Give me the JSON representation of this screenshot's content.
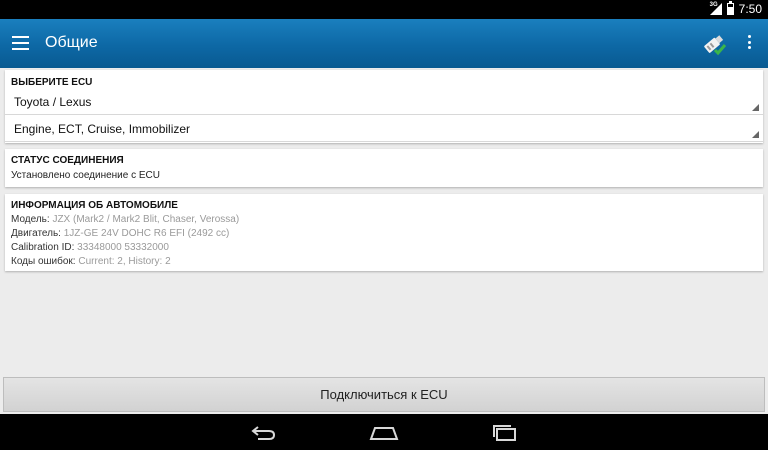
{
  "status_bar": {
    "time": "7:50",
    "network": "3G"
  },
  "app_bar": {
    "title": "Общие"
  },
  "ecu_card": {
    "title": "ВЫБЕРИТЕ ECU",
    "make_selected": "Toyota / Lexus",
    "system_selected": "Engine, ECT, Cruise, Immobilizer"
  },
  "status_card": {
    "title": "СТАТУС СОЕДИНЕНИЯ",
    "text": "Установлено соединение с ECU"
  },
  "vehicle_card": {
    "title": "ИНФОРМАЦИЯ ОБ АВТОМОБИЛЕ",
    "rows": [
      {
        "label": "Модель:",
        "value": "JZX (Mark2 / Mark2 Blit, Chaser, Verossa)"
      },
      {
        "label": "Двигатель:",
        "value": "1JZ-GE 24V DOHC R6 EFI (2492 cc)"
      },
      {
        "label": "Calibration ID:",
        "value": "33348000 53332000"
      },
      {
        "label": "Коды ошибок:",
        "value": "Current: 2, History: 2"
      }
    ]
  },
  "connect_button": {
    "label": "Подключиться к ECU"
  },
  "colors": {
    "app_bar": "#0d68a5",
    "plug_accent": "#3bb54a"
  }
}
